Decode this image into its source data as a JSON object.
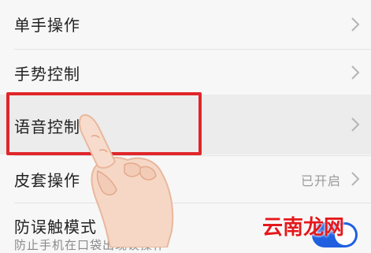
{
  "settings": {
    "items": [
      {
        "label": "单手操作"
      },
      {
        "label": "手势控制"
      },
      {
        "label": "语音控制"
      },
      {
        "label": "皮套操作",
        "status": "已开启"
      },
      {
        "label": "防误触模式",
        "subtitle": "防止手机在口袋出现误操作",
        "toggle_on": true
      }
    ]
  },
  "watermark": {
    "text": "云南龙网"
  },
  "colors": {
    "highlight": "#e0262a",
    "toggle": "#1f5fe0",
    "watermark": "#e4191c"
  }
}
